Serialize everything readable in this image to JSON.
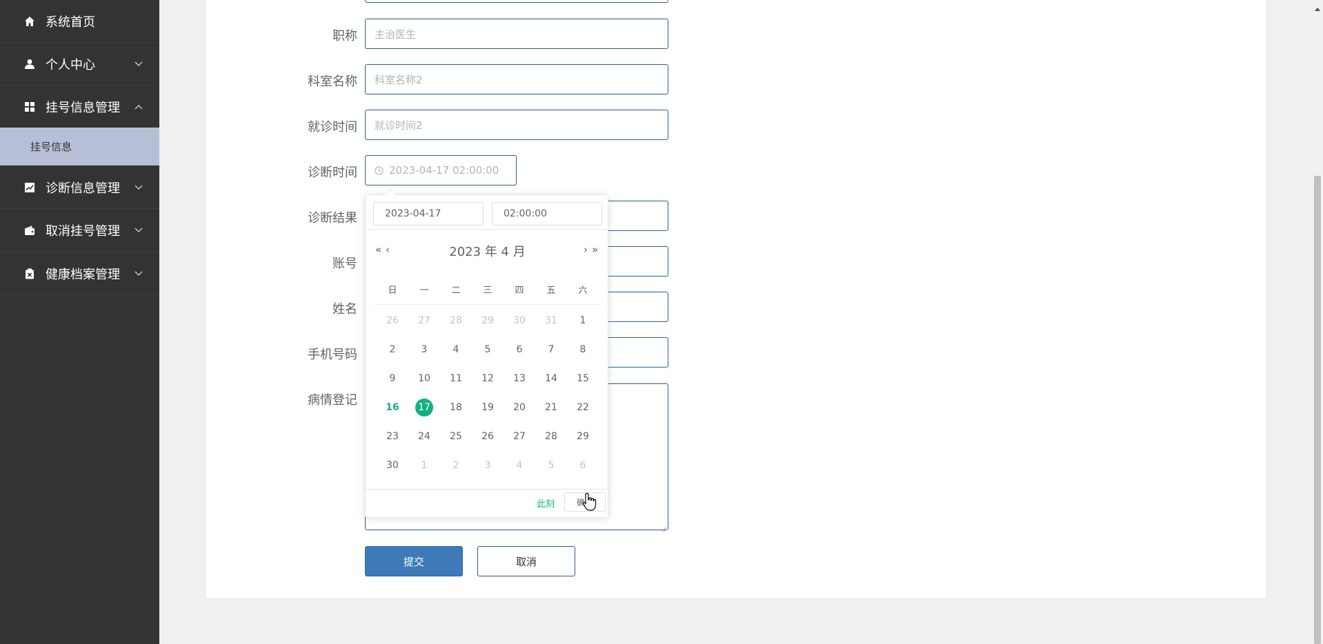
{
  "sidebar": {
    "items": [
      {
        "label": "系统首页",
        "icon": "home-icon"
      },
      {
        "label": "个人中心",
        "icon": "user-icon"
      },
      {
        "label": "挂号信息管理",
        "icon": "grid-icon"
      },
      {
        "label": "诊断信息管理",
        "icon": "chart-icon"
      },
      {
        "label": "取消挂号管理",
        "icon": "wallet-icon"
      },
      {
        "label": "健康档案管理",
        "icon": "clipboard-icon"
      }
    ],
    "submenu": {
      "label": "挂号信息"
    }
  },
  "form": {
    "title_label": "职称",
    "title_placeholder": "主治医生",
    "dept_label": "科室名称",
    "dept_placeholder": "科室名称2",
    "visit_label": "就诊时间",
    "visit_placeholder": "就诊时间2",
    "diag_time_label": "诊断时间",
    "diag_time_value": "2023-04-17 02:00:00",
    "diag_result_label": "诊断结果",
    "account_label": "账号",
    "name_label": "姓名",
    "phone_label": "手机号码",
    "illness_label": "病情登记",
    "submit_label": "提交",
    "cancel_label": "取消"
  },
  "picker": {
    "date_value": "2023-04-17",
    "time_value": "02:00:00",
    "title": "2023 年  4 月",
    "prev_year": "«",
    "prev_month": "‹",
    "next_month": "›",
    "next_year": "»",
    "weekdays": [
      "日",
      "一",
      "二",
      "三",
      "四",
      "五",
      "六"
    ],
    "weeks": [
      [
        {
          "d": "26",
          "m": true
        },
        {
          "d": "27",
          "m": true
        },
        {
          "d": "28",
          "m": true
        },
        {
          "d": "29",
          "m": true
        },
        {
          "d": "30",
          "m": true
        },
        {
          "d": "31",
          "m": true
        },
        {
          "d": "1"
        }
      ],
      [
        {
          "d": "2"
        },
        {
          "d": "3"
        },
        {
          "d": "4"
        },
        {
          "d": "5"
        },
        {
          "d": "6"
        },
        {
          "d": "7"
        },
        {
          "d": "8"
        }
      ],
      [
        {
          "d": "9"
        },
        {
          "d": "10"
        },
        {
          "d": "11"
        },
        {
          "d": "12"
        },
        {
          "d": "13"
        },
        {
          "d": "14"
        },
        {
          "d": "15"
        }
      ],
      [
        {
          "d": "16",
          "today": true
        },
        {
          "d": "17",
          "selected": true
        },
        {
          "d": "18"
        },
        {
          "d": "19"
        },
        {
          "d": "20"
        },
        {
          "d": "21"
        },
        {
          "d": "22"
        }
      ],
      [
        {
          "d": "23"
        },
        {
          "d": "24"
        },
        {
          "d": "25"
        },
        {
          "d": "26"
        },
        {
          "d": "27"
        },
        {
          "d": "28"
        },
        {
          "d": "29"
        }
      ],
      [
        {
          "d": "30"
        },
        {
          "d": "1",
          "m": true
        },
        {
          "d": "2",
          "m": true
        },
        {
          "d": "3",
          "m": true
        },
        {
          "d": "4",
          "m": true
        },
        {
          "d": "5",
          "m": true
        },
        {
          "d": "6",
          "m": true
        }
      ]
    ],
    "now_label": "此刻",
    "ok_label": "确定"
  },
  "colors": {
    "sidebar_bg": "#333333",
    "submenu_bg": "#b6bfd6",
    "accent_green": "#13b07f",
    "submit_blue": "#3d7ab7",
    "input_border": "#2b5d8c"
  }
}
